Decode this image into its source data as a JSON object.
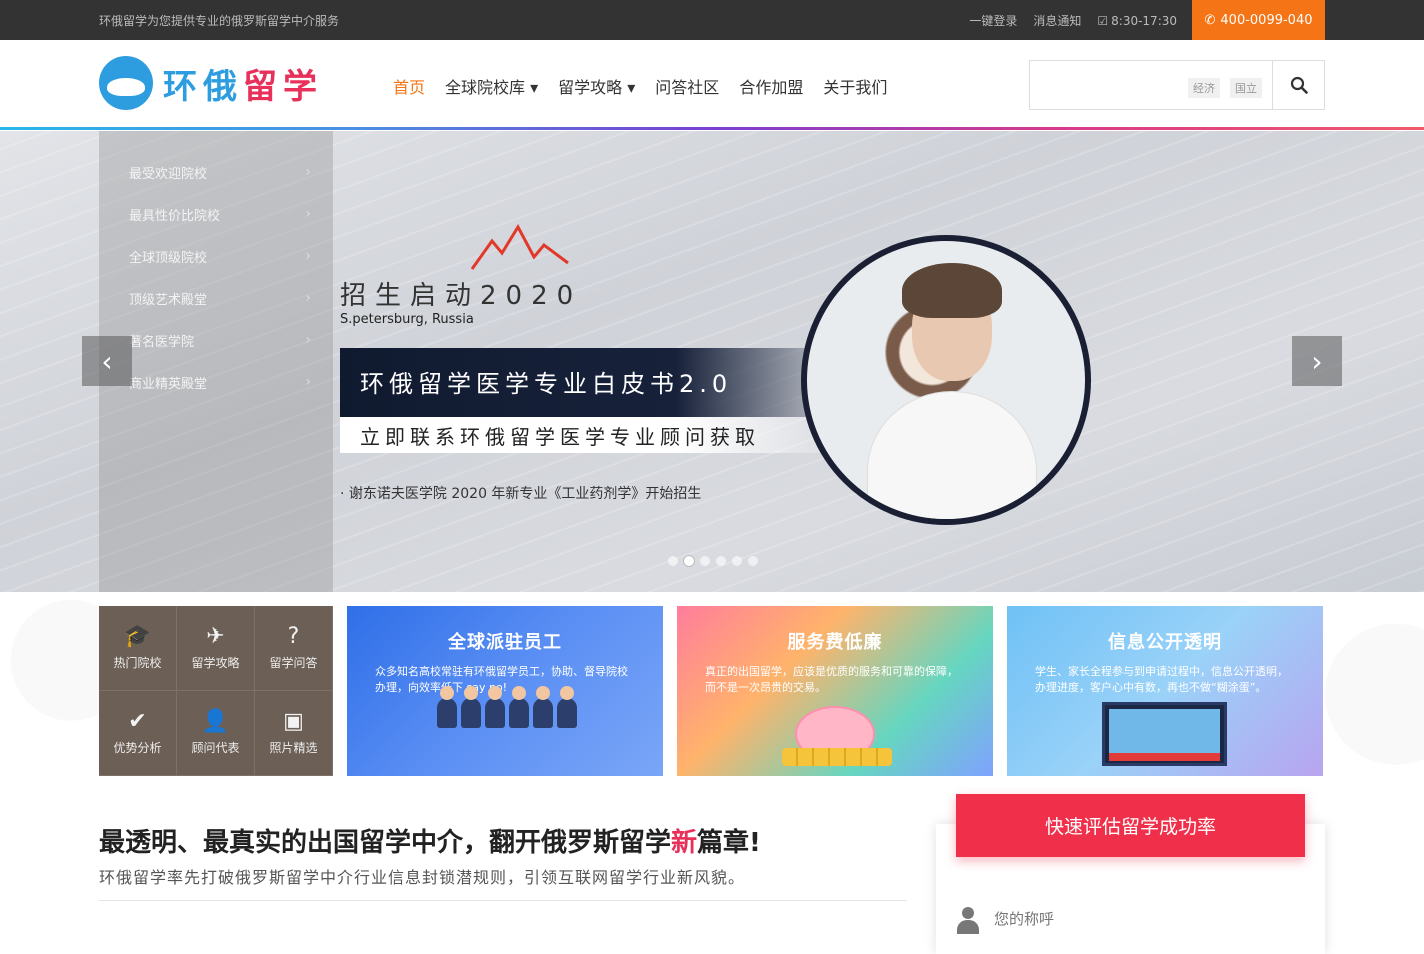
{
  "topbar": {
    "slogan": "环俄留学为您提供专业的俄罗斯留学中介服务",
    "login": "一键登录",
    "notice": "消息通知",
    "hours": "8:30-17:30",
    "phone": "400-0099-040"
  },
  "header": {
    "logo_text_a": "环俄",
    "logo_text_b": "留学",
    "nav": [
      {
        "label": "首页"
      },
      {
        "label": "全球院校库"
      },
      {
        "label": "留学攻略"
      },
      {
        "label": "问答社区"
      },
      {
        "label": "合作加盟"
      },
      {
        "label": "关于我们"
      }
    ],
    "search": {
      "tags": [
        "经济",
        "国立"
      ]
    }
  },
  "sidemenu": [
    {
      "label": "最受欢迎院校"
    },
    {
      "label": "最具性价比院校"
    },
    {
      "label": "全球顶级院校"
    },
    {
      "label": "顶级艺术殿堂"
    },
    {
      "label": "著名医学院"
    },
    {
      "label": "商业精英殿堂"
    }
  ],
  "banner": {
    "recruit": "招生启动2020",
    "city": "S.petersburg, Russia",
    "title": "环俄留学医学专业白皮书2.0",
    "contact": "立即联系环俄留学医学专业顾问获取",
    "note": "· 谢东诺夫医学院 2020 年新专业《工业药剂学》开始招生",
    "dots": 6,
    "active_dot": 1
  },
  "quickgrid": [
    {
      "label": "热门院校",
      "icon": "graduation-cap-icon",
      "glyph": "🎓"
    },
    {
      "label": "留学攻略",
      "icon": "plane-icon",
      "glyph": "✈"
    },
    {
      "label": "留学问答",
      "icon": "question-circle-icon",
      "glyph": "?"
    },
    {
      "label": "优势分析",
      "icon": "clipboard-check-icon",
      "glyph": "✔"
    },
    {
      "label": "顾问代表",
      "icon": "user-icon",
      "glyph": "👤"
    },
    {
      "label": "照片精选",
      "icon": "photos-icon",
      "glyph": "▣"
    }
  ],
  "promos": [
    {
      "title": "全球派驻员工",
      "text": "众多知名高校常驻有环俄留学员工，协助、督导院校办理，向效率低下 say no!"
    },
    {
      "title": "服务费低廉",
      "text": "真正的出国留学，应该是优质的服务和可靠的保障，而不是一次昂贵的交易。"
    },
    {
      "title": "信息公开透明",
      "text": "学生、家长全程参与到申请过程中，信息公开透明，办理进度，客户心中有数，再也不做“糊涂蛋”。"
    }
  ],
  "intro": {
    "headline_a": "最透明、最真实的出国留学中介，翻开俄罗斯留学",
    "headline_red": "新",
    "headline_b": "篇章!",
    "subline": "环俄留学率先打破俄罗斯留学中介行业信息封锁潜规则，引领互联网留学行业新风貌。"
  },
  "form": {
    "button": "快速评估留学成功率",
    "name_placeholder": "您的称呼"
  },
  "colors": {
    "accent": "#f57415",
    "brand_blue": "#2e9de0",
    "brand_red": "#e8315a",
    "cta": "#f0304a"
  }
}
